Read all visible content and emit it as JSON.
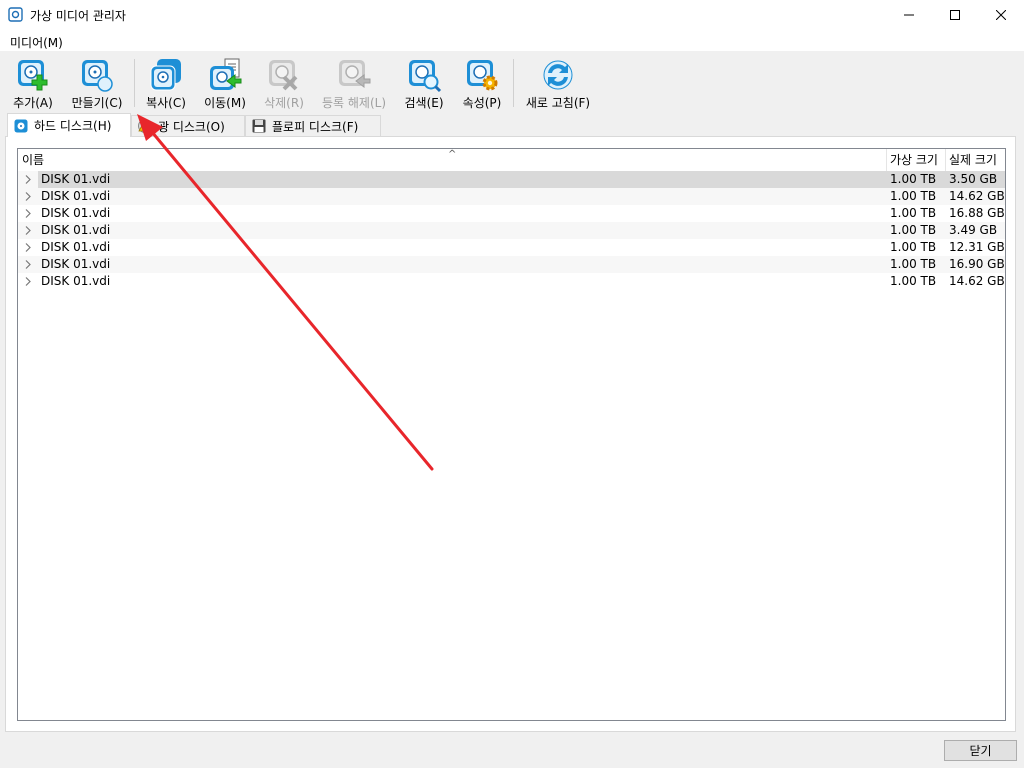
{
  "window": {
    "title": "가상 미디어 관리자",
    "controls": [
      "minimize",
      "maximize",
      "close"
    ]
  },
  "menu": {
    "items": [
      {
        "label": "미디어(M)"
      }
    ]
  },
  "toolbar": {
    "buttons": [
      {
        "label": "추가(A)",
        "icon": "disk-add-icon",
        "enabled": true
      },
      {
        "label": "만들기(C)",
        "icon": "disk-create-icon",
        "enabled": true
      },
      {
        "label": "복사(C)",
        "icon": "disk-copy-icon",
        "enabled": true
      },
      {
        "label": "이동(M)",
        "icon": "disk-move-icon",
        "enabled": true
      },
      {
        "label": "삭제(R)",
        "icon": "disk-remove-icon",
        "enabled": false
      },
      {
        "label": "등록 해제(L)",
        "icon": "disk-release-icon",
        "enabled": false
      },
      {
        "label": "검색(E)",
        "icon": "disk-search-icon",
        "enabled": true
      },
      {
        "label": "속성(P)",
        "icon": "disk-properties-icon",
        "enabled": true
      },
      {
        "label": "새로 고침(F)",
        "icon": "refresh-icon",
        "enabled": true
      }
    ]
  },
  "tabs": [
    {
      "label": "하드 디스크(H)",
      "icon": "hard-disk-icon",
      "active": true
    },
    {
      "label": "광 디스크(O)",
      "icon": "optical-disk-icon",
      "active": false
    },
    {
      "label": "플로피 디스크(F)",
      "icon": "floppy-disk-icon",
      "active": false
    }
  ],
  "table": {
    "columns": [
      "이름",
      "가상 크기",
      "실제 크기"
    ],
    "rows": [
      {
        "name": "DISK 01.vdi",
        "virtual_size": "1.00 TB",
        "actual_size": "3.50 GB",
        "selected": true
      },
      {
        "name": "DISK 01.vdi",
        "virtual_size": "1.00 TB",
        "actual_size": "14.62 GB"
      },
      {
        "name": "DISK 01.vdi",
        "virtual_size": "1.00 TB",
        "actual_size": "16.88 GB"
      },
      {
        "name": "DISK 01.vdi",
        "virtual_size": "1.00 TB",
        "actual_size": "3.49 GB"
      },
      {
        "name": "DISK 01.vdi",
        "virtual_size": "1.00 TB",
        "actual_size": "12.31 GB"
      },
      {
        "name": "DISK 01.vdi",
        "virtual_size": "1.00 TB",
        "actual_size": "16.90 GB"
      },
      {
        "name": "DISK 01.vdi",
        "virtual_size": "1.00 TB",
        "actual_size": "14.62 GB"
      }
    ]
  },
  "footer": {
    "close_label": "닫기"
  },
  "colors": {
    "annotation_arrow": "#e8262b",
    "icon_blue": "#1e8fd6",
    "icon_green": "#2ebd2e"
  }
}
